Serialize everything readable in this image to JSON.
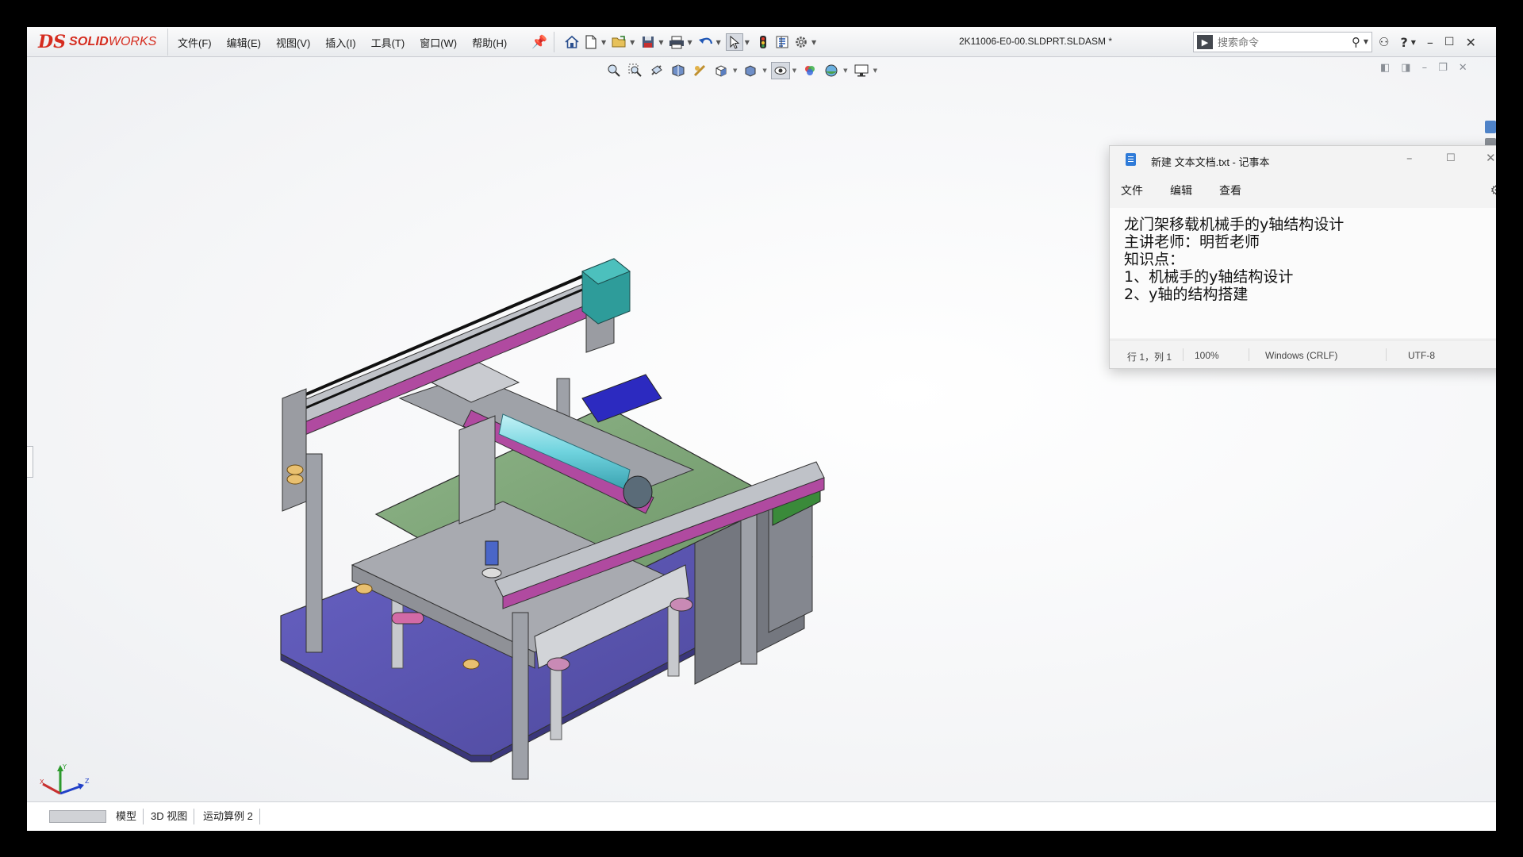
{
  "app": {
    "logo_prefix": "DS",
    "logo_bold": "SOLID",
    "logo_rest": "WORKS",
    "document_title": "2K11006-E0-00.SLDPRT.SLDASM *"
  },
  "menu": [
    "文件(F)",
    "编辑(E)",
    "视图(V)",
    "插入(I)",
    "工具(T)",
    "窗口(W)",
    "帮助(H)"
  ],
  "search": {
    "placeholder": "搜索命令"
  },
  "bottom_tabs": [
    "模型",
    "3D 视图",
    "运动算例 2"
  ],
  "notepad": {
    "title": "新建 文本文档.txt - 记事本",
    "menu": [
      "文件",
      "编辑",
      "查看"
    ],
    "lines": [
      "龙门架移载机械手的y轴结构设计",
      "主讲老师：明哲老师",
      "知识点：",
      "1、机械手的y轴结构设计",
      "2、y轴的结构搭建"
    ],
    "status": {
      "position": "行 1，列 1",
      "zoom": "100%",
      "line_ending": "Windows (CRLF)",
      "encoding": "UTF-8"
    }
  },
  "triad": {
    "x": "X",
    "y": "Y",
    "z": "Z"
  },
  "colors": {
    "brand_red": "#d52b1e",
    "base_plate": "#5b56b8",
    "conveyor_green": "#7fa37a",
    "rail_pink": "#b04aa0",
    "frame_gray": "#8c8f96",
    "shaft_cyan": "#7fd8e0",
    "motor_teal": "#2e9c9a"
  }
}
